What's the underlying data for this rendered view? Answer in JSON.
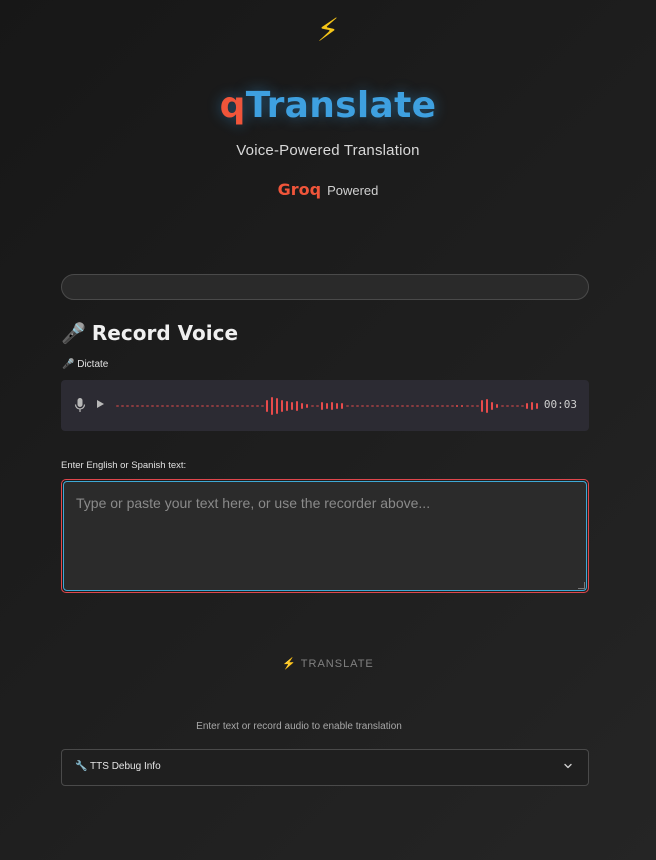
{
  "header": {
    "bolt_icon": "⚡",
    "logo_q": "q",
    "logo_rest": "Translate",
    "subtitle": "Voice-Powered Translation",
    "groq": "Groq",
    "powered": "Powered"
  },
  "progress": {
    "value": 0
  },
  "record": {
    "title_icon": "🎤",
    "title": "Record Voice",
    "dictate_label": "🎤 Dictate",
    "timer": "00:03"
  },
  "input": {
    "label": "Enter English or Spanish text:",
    "placeholder": "Type or paste your text here, or use the recorder above...",
    "value": ""
  },
  "translate": {
    "label": "⚡ TRANSLATE"
  },
  "hint": "Enter text or record audio to enable translation",
  "debug": {
    "label": "🔧 TTS Debug Info"
  },
  "colors": {
    "accent_red": "#f0553a",
    "accent_blue": "#3ea0e0",
    "wave": "#e84b4b"
  }
}
